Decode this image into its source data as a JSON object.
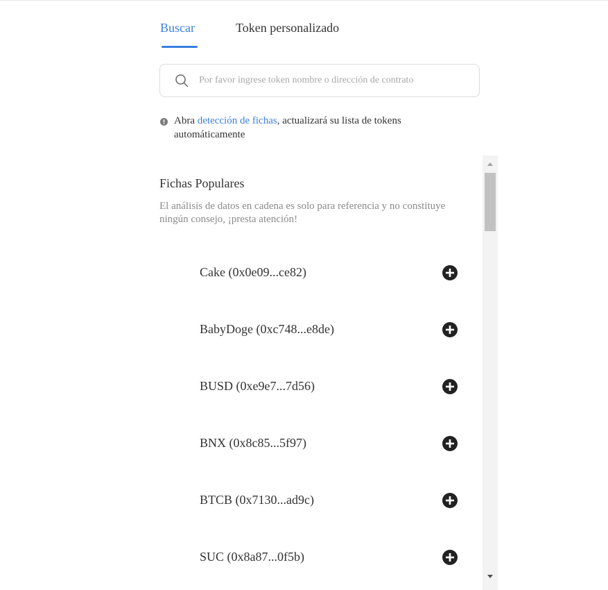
{
  "tabs": [
    {
      "label": "Buscar",
      "active": true
    },
    {
      "label": "Token personalizado",
      "active": false
    }
  ],
  "search": {
    "value": "",
    "placeholder": "Por favor ingrese token nombre o dirección de contrato",
    "icon": "search-icon"
  },
  "notice": {
    "icon": "info-icon",
    "prefix": "Abra ",
    "link": "detección de fichas",
    "suffix": ", actualizará su lista de tokens",
    "line2": "automáticamente"
  },
  "popular": {
    "title": "Fichas Populares",
    "description": "El análisis de datos en cadena es solo para referencia y no constituye ningún consejo, ¡presta atención!",
    "tokens": [
      {
        "label": "Cake (0x0e09...ce82)",
        "action_icon": "add-circle-icon"
      },
      {
        "label": "BabyDoge (0xc748...e8de)",
        "action_icon": "add-circle-icon"
      },
      {
        "label": "BUSD (0xe9e7...7d56)",
        "action_icon": "add-circle-icon"
      },
      {
        "label": "BNX (0x8c85...5f97)",
        "action_icon": "add-circle-icon"
      },
      {
        "label": "BTCB (0x7130...ad9c)",
        "action_icon": "add-circle-icon"
      },
      {
        "label": "SUC (0x8a87...0f5b)",
        "action_icon": "add-circle-icon"
      }
    ]
  },
  "colors": {
    "accent": "#3b7fe0",
    "text": "#333333",
    "muted": "#8a8a8a"
  }
}
